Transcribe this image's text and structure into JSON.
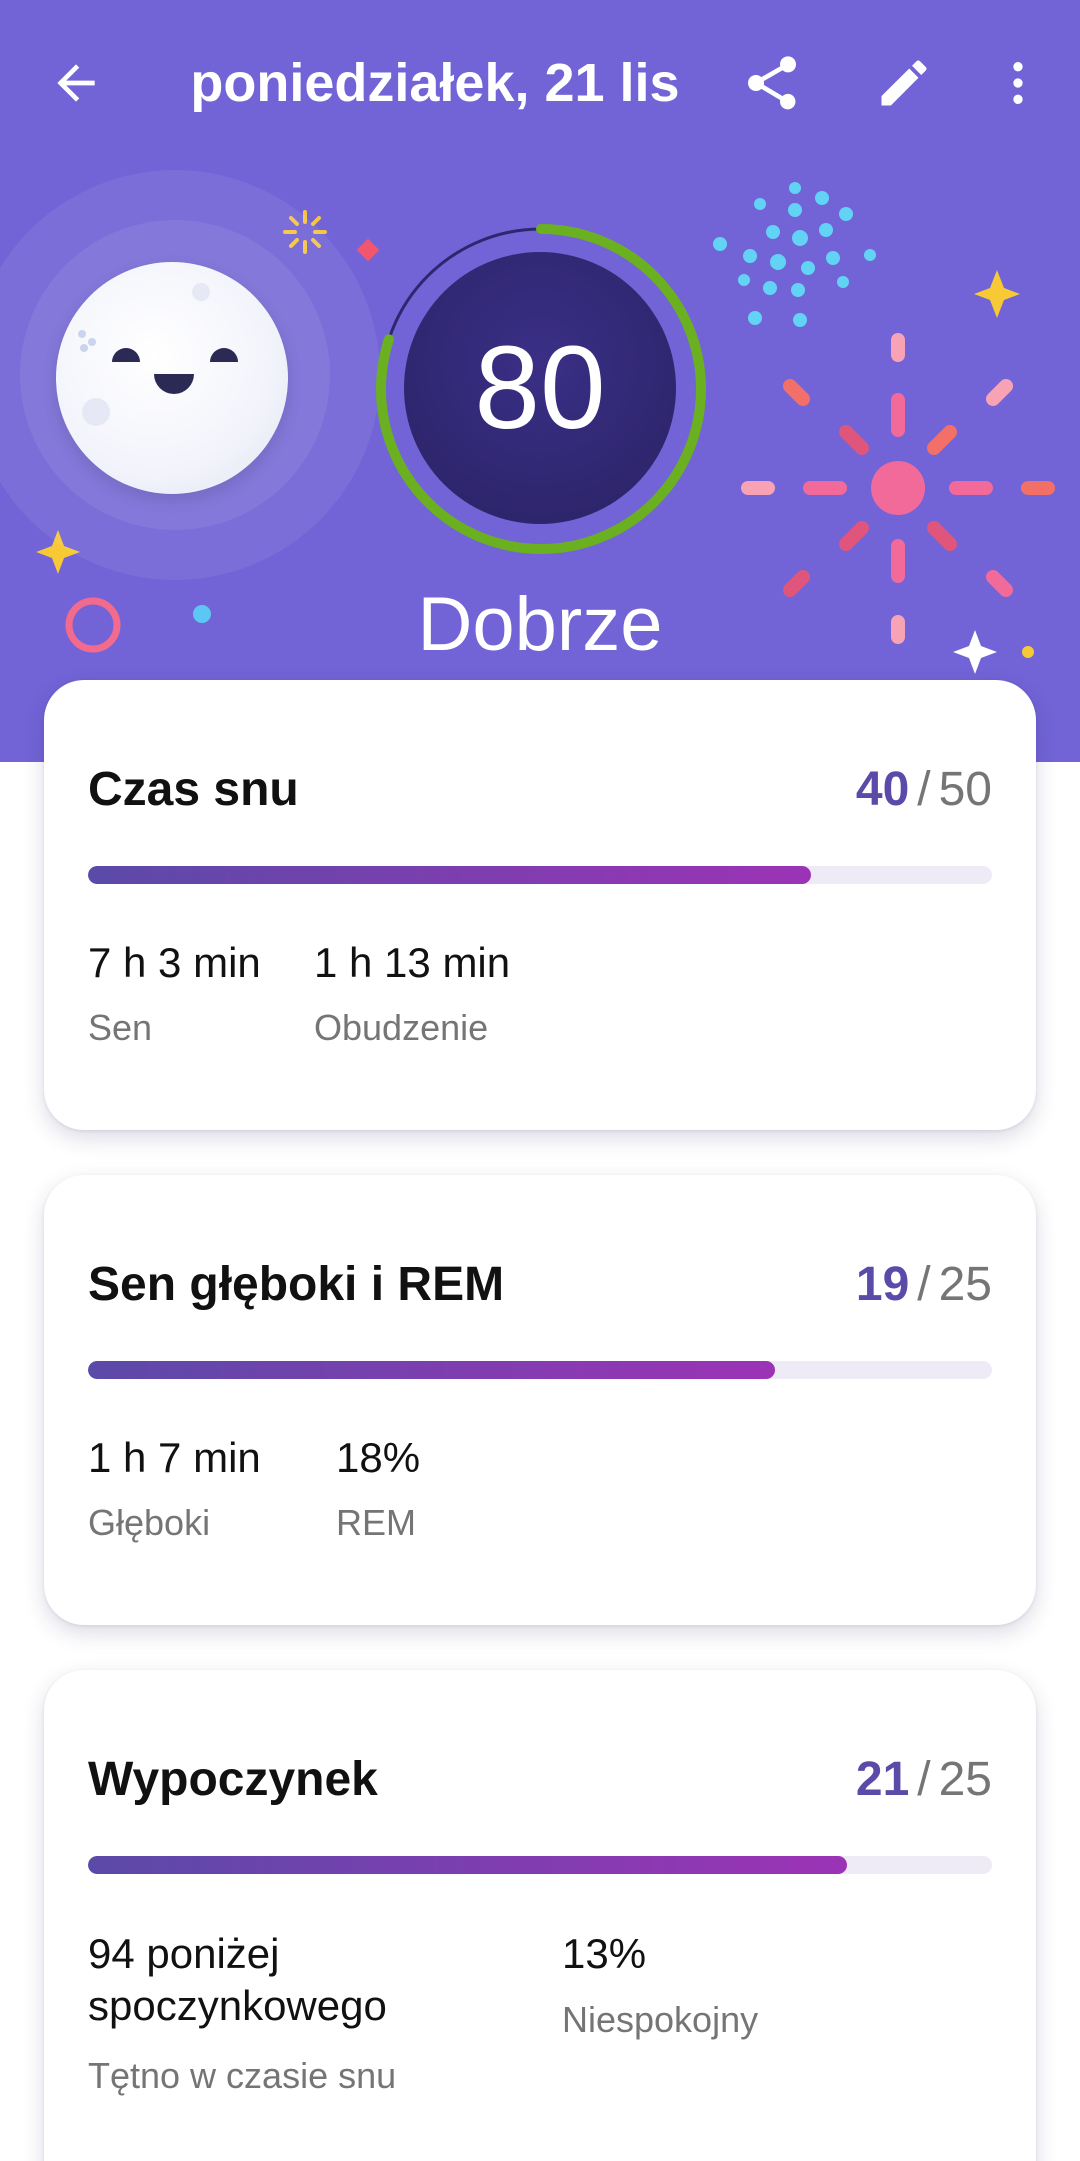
{
  "appbar": {
    "title": "poniedziałek, 21 lis",
    "back_icon": "arrow-back-icon",
    "share_icon": "share-icon",
    "edit_icon": "pencil-icon",
    "more_icon": "more-vert-icon"
  },
  "summary": {
    "score": "80",
    "score_fraction": 0.8,
    "rating": "Dobrze",
    "mascot": "moon-mascot"
  },
  "colors": {
    "header_bg": "#7264d6",
    "ring_green": "#6ab020",
    "accent": "#5b4aa8",
    "bar_end": "#9c33b6"
  },
  "cards": [
    {
      "title": "Czas snu",
      "score": "40",
      "max": "50",
      "progress": 0.8,
      "stats": [
        {
          "value": "7 h 3 min",
          "label": "Sen"
        },
        {
          "value": "1 h 13 min",
          "label": "Obudzenie"
        }
      ]
    },
    {
      "title": "Sen głęboki i REM",
      "score": "19",
      "max": "25",
      "progress": 0.76,
      "stats": [
        {
          "value": "1 h 7 min",
          "label": "Głęboki"
        },
        {
          "value": "18%",
          "label": "REM"
        }
      ]
    },
    {
      "title": "Wypoczynek",
      "score": "21",
      "max": "25",
      "progress": 0.84,
      "stats": [
        {
          "value_line1": "94 poniżej",
          "value_line2": "spoczynkowego",
          "label": "Tętno w czasie snu"
        },
        {
          "value": "13%",
          "label": "Niespokojny"
        }
      ]
    }
  ]
}
